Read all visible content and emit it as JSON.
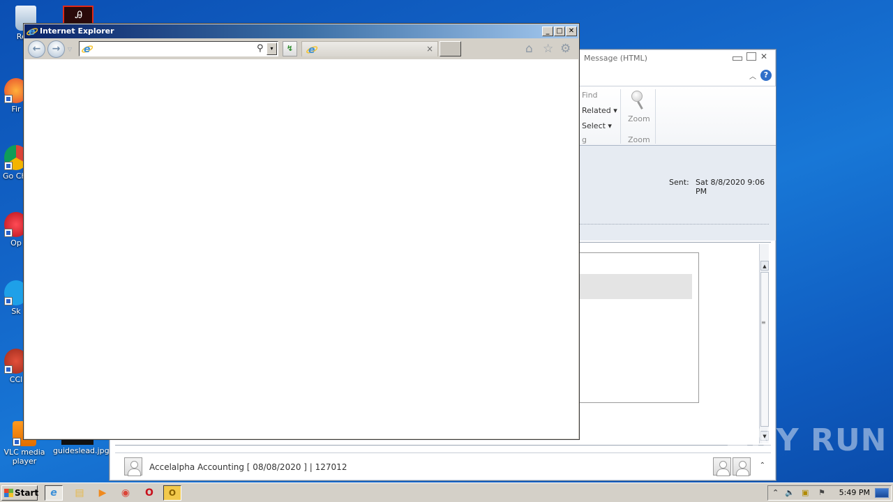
{
  "desktop": {
    "icons": [
      {
        "label": "Recy",
        "icon": "recycle-bin-icon"
      },
      {
        "label": "Fir",
        "icon": "firefox-icon"
      },
      {
        "label": "Go Chr",
        "icon": "chrome-icon"
      },
      {
        "label": "Op",
        "icon": "opera-icon"
      },
      {
        "label": "Sk",
        "icon": "skype-icon"
      },
      {
        "label": "CCl",
        "icon": "ccleaner-icon"
      },
      {
        "label": "VLC media player",
        "icon": "vlc-icon"
      },
      {
        "label": "guideslead.jpg",
        "icon": "image-file-icon"
      }
    ],
    "watermark": "ANY RUN"
  },
  "ie": {
    "title": "Internet Explorer",
    "address_value": "",
    "tab_title": "",
    "buttons": {
      "minimize": "_",
      "maximize": "□",
      "close": "✕",
      "back": "←",
      "forward": "→",
      "nav_dropdown": "▽",
      "addr_dropdown": "▾",
      "search": "⚲",
      "compat": "↯",
      "tab_close": "×",
      "home": "⌂",
      "favorites": "☆",
      "tools": "⚙"
    }
  },
  "outlook": {
    "title": "Message (HTML)",
    "ribbon": {
      "find": "Find",
      "related": "Related ▾",
      "select": "Select ▾",
      "group_editing_partial": "g",
      "zoom_button": "Zoom",
      "zoom_group": "Zoom",
      "collapse": "︿",
      "help": "?"
    },
    "header": {
      "sent_label": "Sent:",
      "sent_value": "Sat 8/8/2020 9:06 PM"
    },
    "footer": {
      "people_text": "Accelalpha Accounting [ 08/08/2020 ] | 127012",
      "expand": "⌃"
    }
  },
  "taskbar": {
    "start_label": "Start",
    "apps": [
      {
        "name": "internet-explorer",
        "glyph": "e",
        "active": true
      },
      {
        "name": "windows-explorer",
        "glyph": "▤",
        "active": false
      },
      {
        "name": "media-player",
        "glyph": "▶",
        "active": false
      },
      {
        "name": "chrome",
        "glyph": "◉",
        "active": false
      },
      {
        "name": "opera",
        "glyph": "O",
        "active": false
      },
      {
        "name": "outlook",
        "glyph": "O",
        "active": false
      }
    ],
    "tray": {
      "show_hidden": "⌃",
      "volume": "🔈",
      "network": "▣",
      "action_center": "⚑",
      "clock": "5:49 PM"
    }
  }
}
